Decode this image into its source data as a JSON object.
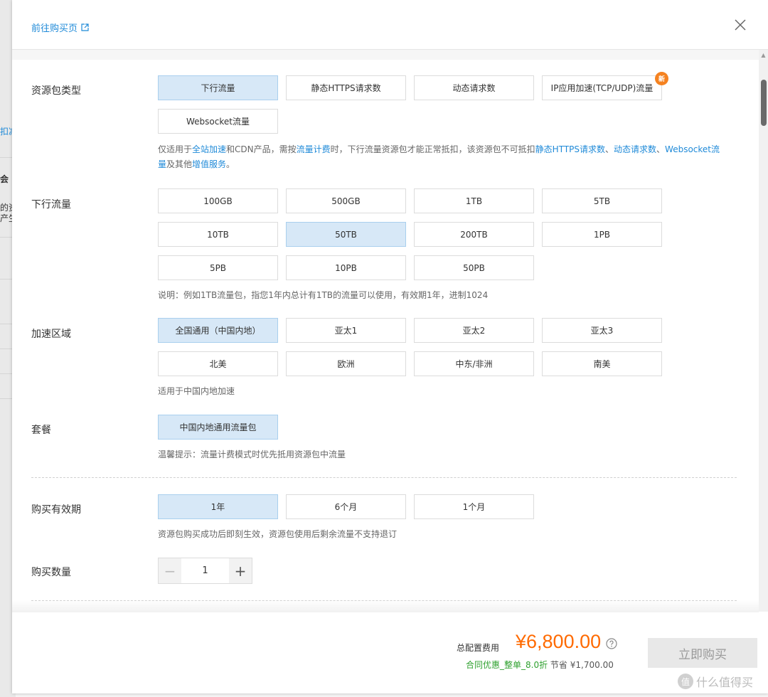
{
  "background": {
    "fragments": [
      "扣减",
      "会",
      "的资",
      "产生"
    ]
  },
  "header": {
    "buy_link": "前往购买页"
  },
  "package_type": {
    "label": "资源包类型",
    "options": [
      "下行流量",
      "静态HTTPS请求数",
      "动态请求数",
      "IP应用加速(TCP/UDP)流量",
      "Websocket流量"
    ],
    "selected": "下行流量",
    "new_badge": "新",
    "note": {
      "p1": "仅适用于",
      "link1": "全站加速",
      "p2": "和CDN产品，需按",
      "link2": "流量计费",
      "p3": "时，下行流量资源包才能正常抵扣，该资源包不可抵扣",
      "link3": "静态HTTPS请求数",
      "p4": "、",
      "link4": "动态请求数",
      "p5": "、",
      "link5": "Websocket流量",
      "p6": "及其他",
      "link6": "增值服务",
      "p7": "。"
    }
  },
  "downstream": {
    "label": "下行流量",
    "options": [
      "100GB",
      "500GB",
      "1TB",
      "5TB",
      "10TB",
      "50TB",
      "200TB",
      "1PB",
      "5PB",
      "10PB",
      "50PB"
    ],
    "selected": "50TB",
    "note": "说明：例如1TB流量包，指您1年内总计有1TB的流量可以使用，有效期1年，进制1024"
  },
  "region": {
    "label": "加速区域",
    "options": [
      "全国通用（中国内地）",
      "亚太1",
      "亚太2",
      "亚太3",
      "北美",
      "欧洲",
      "中东/非洲",
      "南美"
    ],
    "selected": "全国通用（中国内地）",
    "note": "适用于中国内地加速"
  },
  "plan": {
    "label": "套餐",
    "options": [
      "中国内地通用流量包"
    ],
    "selected": "中国内地通用流量包",
    "note": "温馨提示：流量计费模式时优先抵用资源包中流量"
  },
  "validity": {
    "label": "购买有效期",
    "options": [
      "1年",
      "6个月",
      "1个月"
    ],
    "selected": "1年",
    "note": "资源包购买成功后即刻生效，资源包使用后剩余流量不支持退订"
  },
  "quantity": {
    "label": "购买数量",
    "value": "1",
    "minus": "−",
    "plus": "+"
  },
  "footer": {
    "total_label": "总配置费用",
    "price": "¥6,800.00",
    "discount": "合同优惠_整单_8.0折",
    "save_label": "节省",
    "save_amount": "¥1,700.00",
    "buy_button": "立即购买"
  },
  "watermark": {
    "logo": "值",
    "text": "什么值得买"
  },
  "colors": {
    "link": "#1f8ad8",
    "selected_bg": "#d7e8f7",
    "price": "#ff6a00",
    "discount": "#2fa12f",
    "badge": "#f58220"
  }
}
